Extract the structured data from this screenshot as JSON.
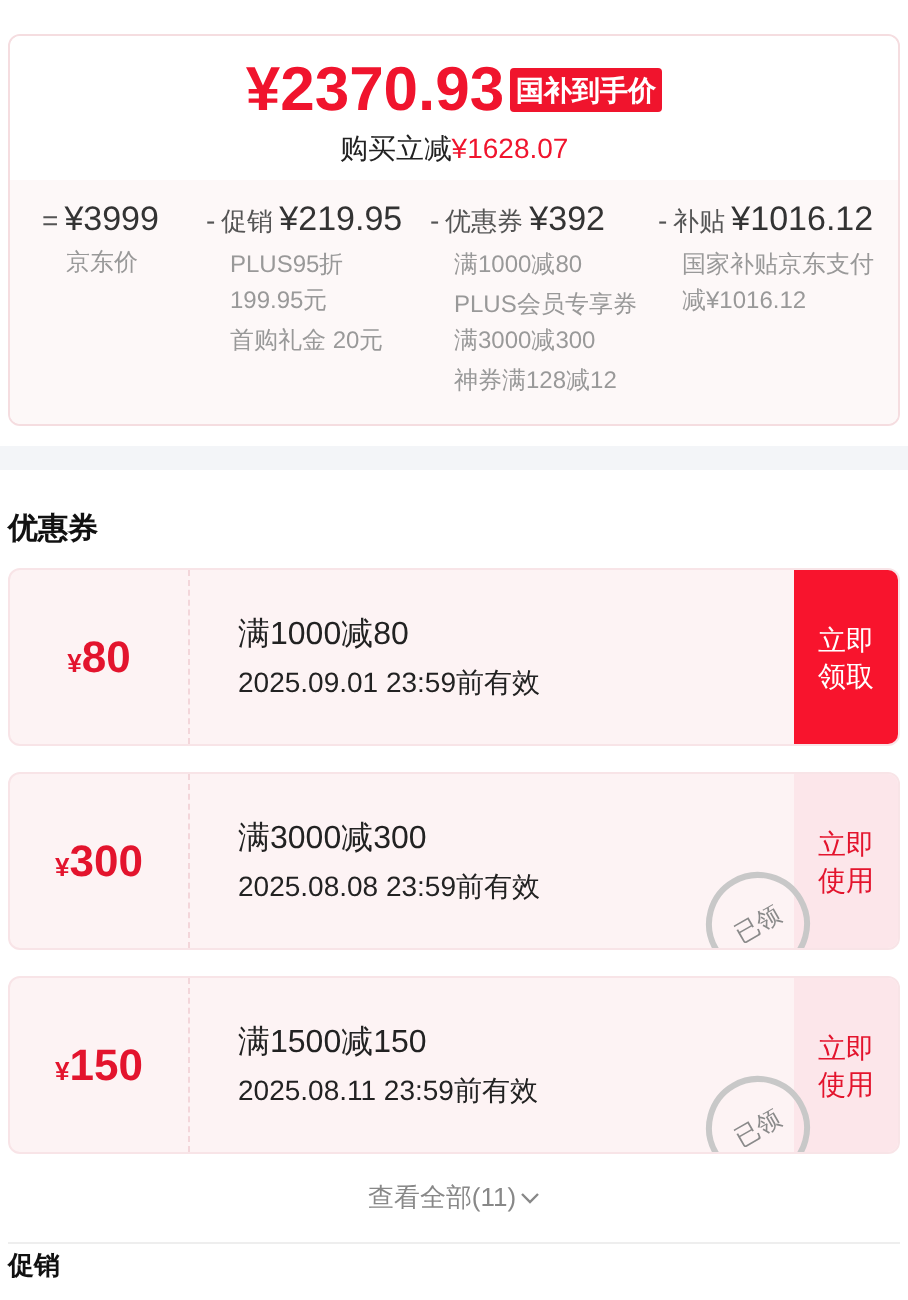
{
  "price": {
    "amount": "¥2370.93",
    "badge": "国补到手价",
    "saving_label": "购买立减",
    "saving": "¥1628.07"
  },
  "breakdown": [
    {
      "operator": "=",
      "value": "¥3999",
      "details": [
        "京东价"
      ]
    },
    {
      "operator": "-",
      "label": "促销",
      "value": "¥219.95",
      "details": [
        "PLUS95折 199.95元",
        "首购礼金 20元"
      ]
    },
    {
      "operator": "-",
      "label": "优惠券",
      "value": "¥392",
      "details": [
        "满1000减80",
        "PLUS会员专享券满3000减300",
        "神券满128减12"
      ]
    },
    {
      "operator": "-",
      "label": "补贴",
      "value": "¥1016.12",
      "details": [
        "国家补贴京东支付减¥1016.12"
      ]
    }
  ],
  "coupons_title": "优惠券",
  "coupons": [
    {
      "currency": "¥",
      "amount": "80",
      "condition": "满1000减80",
      "validity": "2025.09.01 23:59前有效",
      "action": "立即领取",
      "claimed": false
    },
    {
      "currency": "¥",
      "amount": "300",
      "condition": "满3000减300",
      "validity": "2025.08.08 23:59前有效",
      "action": "立即使用",
      "claimed": true,
      "stamp": "已领"
    },
    {
      "currency": "¥",
      "amount": "150",
      "condition": "满1500减150",
      "validity": "2025.08.11 23:59前有效",
      "action": "立即使用",
      "claimed": true,
      "stamp": "已领"
    }
  ],
  "view_all": "查看全部(11)",
  "next_section_title": "促销"
}
